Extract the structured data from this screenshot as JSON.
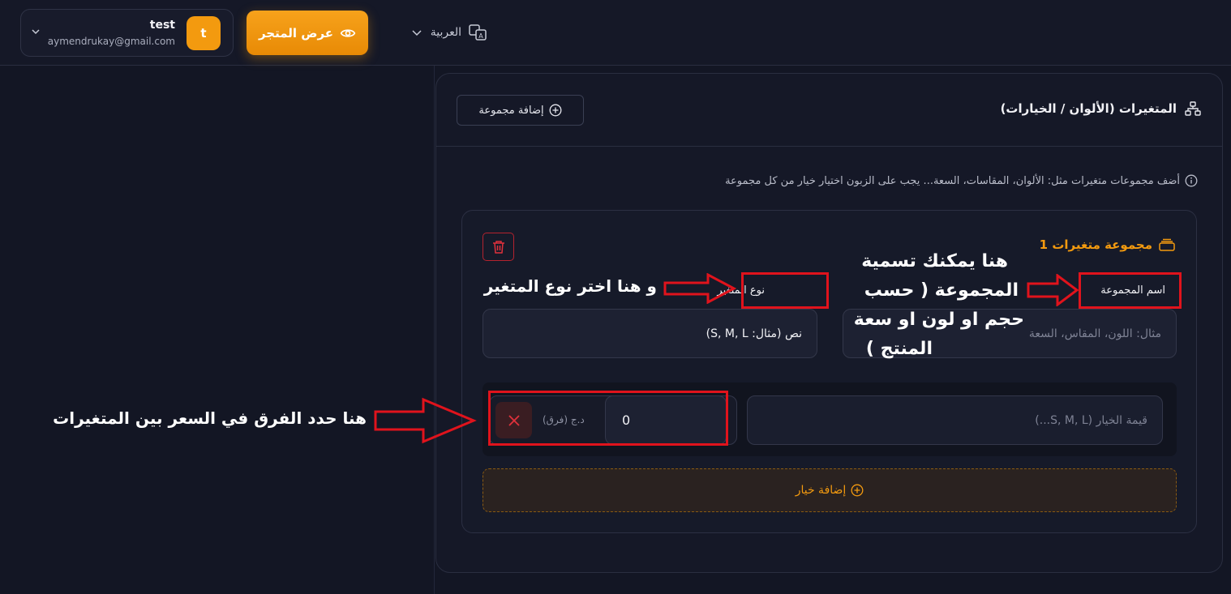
{
  "topbar": {
    "user": {
      "name": "test",
      "email": "aymendrukay@gmail.com",
      "avatar_letter": "t"
    },
    "store_button": "عرض المتجر",
    "language": "العربية"
  },
  "variants": {
    "title": "المتغيرات (الألوان / الخيارات)",
    "add_group": "إضافة مجموعة",
    "hint": "أضف مجموعات متغيرات مثل: الألوان، المقاسات، السعة... يجب على الزبون اختيار خيار من كل مجموعة",
    "group": {
      "title": "مجموعة متغيرات 1",
      "name_label": "اسم المجموعة",
      "name_placeholder": "مثال: اللون، المقاس، السعة",
      "type_label": "نوع المتغير",
      "type_value": "نص (مثال: S, M, L)",
      "option_placeholder": "قيمة الخيار (S, M, L...)",
      "price_value": "0",
      "price_unit": "د.ج (فرق)",
      "add_option": "إضافة خيار"
    }
  },
  "annotations": {
    "name_note_line1": "هنا يمكنك تسمية",
    "name_note_line2": "المجموعة ( حسب",
    "name_note_line3": "حجم او لون او سعة",
    "name_note_line4": "المنتج )",
    "type_note": "و هنا اختر نوع المتغير",
    "price_note": "هنا حدد الفرق في السعر بين المتغيرات"
  },
  "colors": {
    "accent": "#f39a0f",
    "annotation_red": "#e0131c",
    "background": "#131624"
  }
}
